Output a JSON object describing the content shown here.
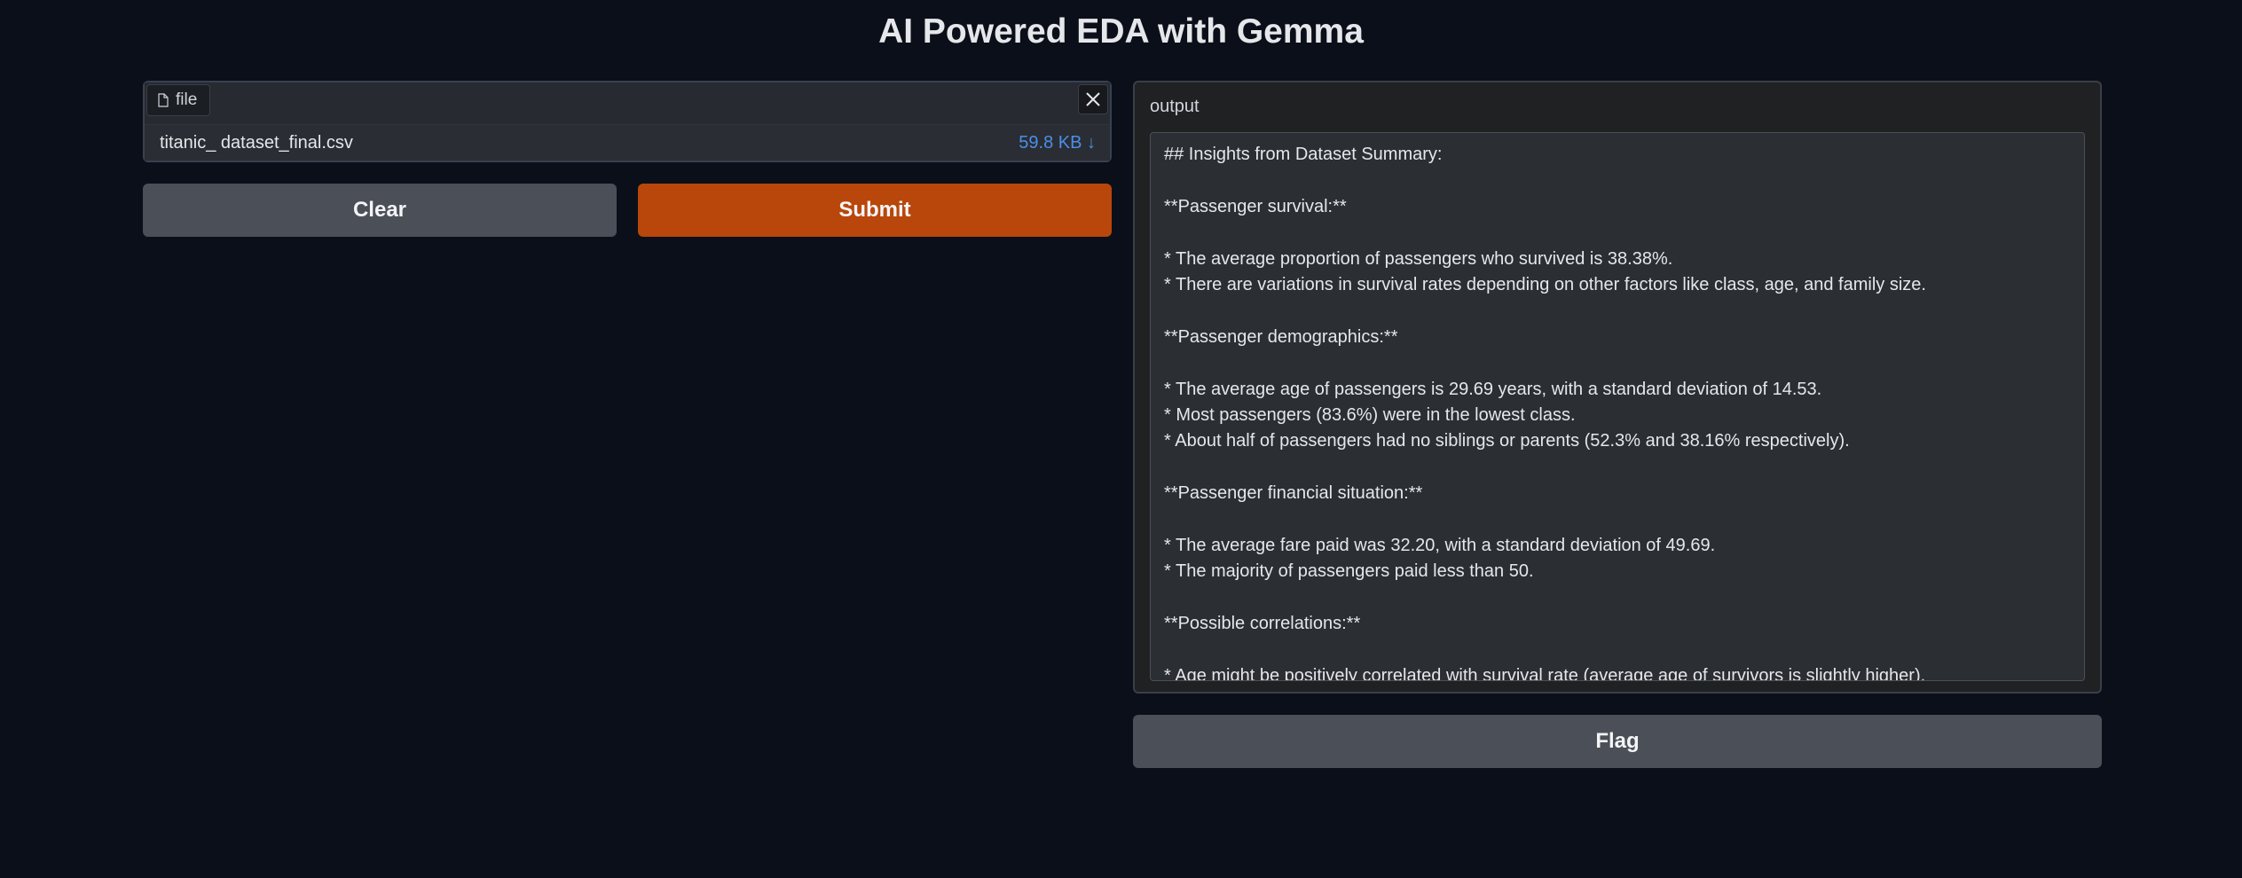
{
  "app": {
    "title": "AI Powered EDA with Gemma"
  },
  "file_input": {
    "label": "file",
    "file_name": "titanic_ dataset_final.csv",
    "file_size": "59.8 KB ↓"
  },
  "buttons": {
    "clear": "Clear",
    "submit": "Submit",
    "flag": "Flag"
  },
  "output": {
    "label": "output",
    "lines": [
      "## Insights from Dataset Summary:",
      "",
      "**Passenger survival:**",
      "",
      "* The average proportion of passengers who survived is 38.38%.",
      "* There are variations in survival rates depending on other factors like class, age, and family size.",
      "",
      "**Passenger demographics:**",
      "",
      "* The average age of passengers is 29.69 years, with a standard deviation of 14.53.",
      "* Most passengers (83.6%) were in the lowest class.",
      "* About half of passengers had no siblings or parents (52.3% and 38.16% respectively).",
      "",
      "**Passenger financial situation:**",
      "",
      "* The average fare paid was 32.20, with a standard deviation of 49.69.",
      "* The majority of passengers paid less than 50.",
      "",
      "**Possible correlations:**",
      "",
      "* Age might be positively correlated with survival rate (average age of survivors is slightly higher)."
    ]
  },
  "colors": {
    "background": "#0b0f19",
    "submit": "#b9460b",
    "secondary_button": "#4b5058",
    "file_size_link": "#4b8fe8"
  }
}
